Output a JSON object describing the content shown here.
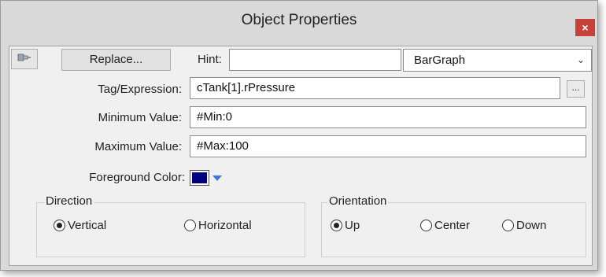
{
  "window": {
    "title": "Object Properties",
    "close_glyph": "×"
  },
  "toolbar": {
    "pin_icon": "pin-icon",
    "replace_label": "Replace...",
    "hint_label": "Hint:",
    "hint_value": "",
    "type_selected": "BarGraph"
  },
  "fields": {
    "tag_label": "Tag/Expression:",
    "tag_value": "cTank[1].rPressure",
    "browse_label": "...",
    "min_label": "Minimum Value:",
    "min_value": "#Min:0",
    "max_label": "Maximum Value:",
    "max_value": "#Max:100",
    "fg_label": "Foreground Color:",
    "fg_color": "#000080"
  },
  "direction": {
    "title": "Direction",
    "options": [
      {
        "label": "Vertical",
        "checked": true
      },
      {
        "label": "Horizontal",
        "checked": false
      }
    ]
  },
  "orientation": {
    "title": "Orientation",
    "options": [
      {
        "label": "Up",
        "checked": true
      },
      {
        "label": "Center",
        "checked": false
      },
      {
        "label": "Down",
        "checked": false
      }
    ]
  }
}
